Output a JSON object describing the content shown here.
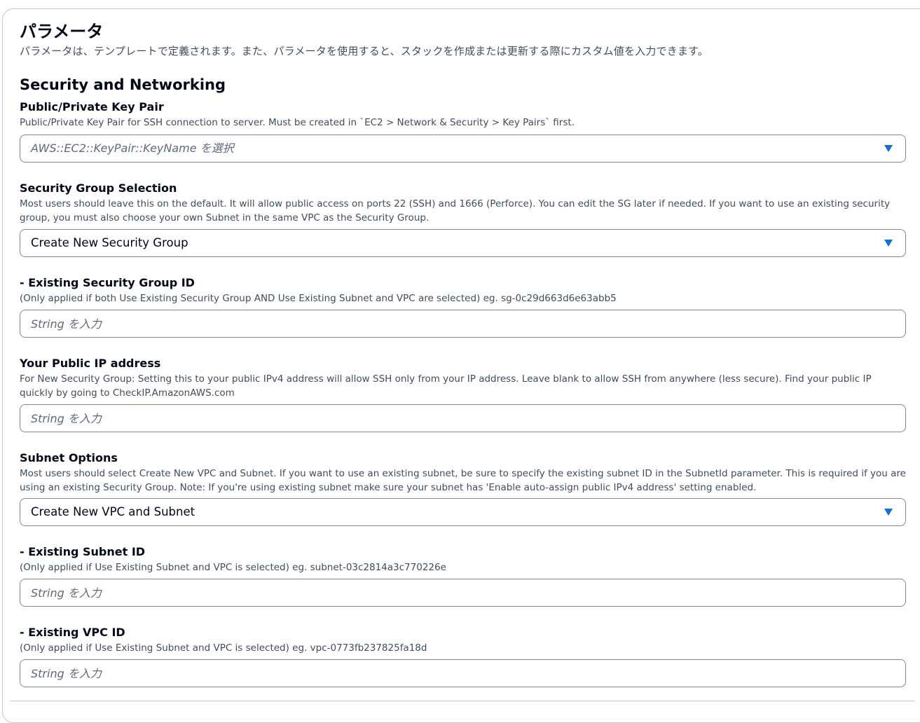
{
  "page": {
    "title": "パラメータ",
    "description": "パラメータは、テンプレートで定義されます。また、パラメータを使用すると、スタックを作成または更新する際にカスタム値を入力できます。"
  },
  "section": {
    "title": "Security and Networking"
  },
  "fields": [
    {
      "label": "Public/Private Key Pair",
      "description": "Public/Private Key Pair for SSH connection to server. Must be created in `EC2 > Network & Security > Key Pairs` first.",
      "control": "select",
      "placeholder": "AWS::EC2::KeyPair::KeyName を選択",
      "value": ""
    },
    {
      "label": "Security Group Selection",
      "description": "Most users should leave this on the default. It will allow public access on ports 22 (SSH) and 1666 (Perforce). You can edit the SG later if needed. If you want to use an existing security group, you must also choose your own Subnet in the same VPC as the Security Group.",
      "control": "select",
      "placeholder": "",
      "value": "Create New Security Group"
    },
    {
      "label": "- Existing Security Group ID",
      "description": "(Only applied if both Use Existing Security Group AND Use Existing Subnet and VPC are selected) eg. sg-0c29d663d6e63abb5",
      "control": "input",
      "placeholder": "String を入力",
      "value": ""
    },
    {
      "label": "Your Public IP address",
      "description": "For New Security Group: Setting this to your public IPv4 address will allow SSH only from your IP address. Leave blank to allow SSH from anywhere (less secure). Find your public IP quickly by going to CheckIP.AmazonAWS.com",
      "control": "input",
      "placeholder": "String を入力",
      "value": ""
    },
    {
      "label": "Subnet Options",
      "description": "Most users should select Create New VPC and Subnet. If you want to use an existing subnet, be sure to specify the existing subnet ID in the SubnetId parameter. This is required if you are using an existing Security Group. Note: If you're using existing subnet make sure your subnet has 'Enable auto-assign public IPv4 address' setting enabled.",
      "control": "select",
      "placeholder": "",
      "value": "Create New VPC and Subnet"
    },
    {
      "label": "- Existing Subnet ID",
      "description": "(Only applied if Use Existing Subnet and VPC is selected) eg. subnet-03c2814a3c770226e",
      "control": "input",
      "placeholder": "String を入力",
      "value": ""
    },
    {
      "label": "- Existing VPC ID",
      "description": "(Only applied if Use Existing Subnet and VPC is selected) eg. vpc-0773fb237825fa18d",
      "control": "input",
      "placeholder": "String を入力",
      "value": ""
    }
  ],
  "icons": {
    "dropdown": "caret-down-icon"
  },
  "colors": {
    "accent": "#0972d3",
    "text": "#000716",
    "muted": "#414d5c",
    "border": "#7d8998"
  }
}
